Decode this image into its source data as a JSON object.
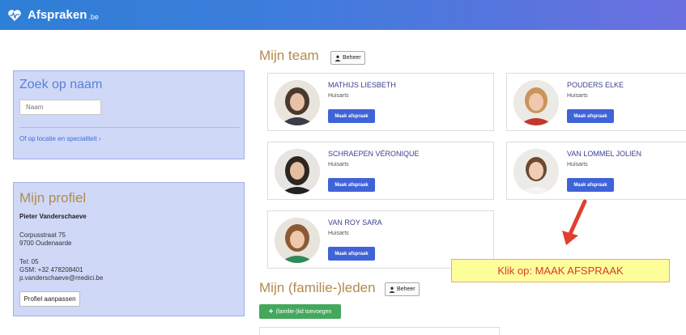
{
  "app": {
    "brand_name": "Afspraken",
    "brand_suffix": ".be"
  },
  "search_panel": {
    "title": "Zoek op naam",
    "input_placeholder": "Naam",
    "location_link": "Of op locatie en specialiteit ›"
  },
  "profile_panel": {
    "title": "Mijn profiel",
    "name": "Pieter Vanderschaeve",
    "street": "Corpusstraat 75",
    "city": "9700 Oudenaarde",
    "tel": "Tel: 05",
    "gsm": "GSM: +32 478208401",
    "email": "p.vanderschaeve@medici.be",
    "edit_button": "Profiel aanpassen"
  },
  "team": {
    "title": "Mijn team",
    "manage_button": "Beheer",
    "doctors": [
      {
        "name": "MATHIJS LIESBETH",
        "role": "Huisarts",
        "button": "Maak afspraak"
      },
      {
        "name": "POUDERS ELKE",
        "role": "Huisarts",
        "button": "Maak afspraak"
      },
      {
        "name": "SCHRAEPEN VÉRONIQUE",
        "role": "Huisarts",
        "button": "Maak afspraak"
      },
      {
        "name": "VAN LOMMEL JOLIEN",
        "role": "Huisarts",
        "button": "Maak afspraak"
      },
      {
        "name": "VAN ROY SARA",
        "role": "Huisarts",
        "button": "Maak afspraak"
      }
    ]
  },
  "family": {
    "title": "Mijn (familie-)leden",
    "manage_button": "Beheer",
    "add_button": "(familie-)lid toevoegen"
  },
  "annotation": {
    "text": "Klik op: MAAK AFSPRAAK",
    "text_color": "#d93a2b",
    "background": "#fdfd9a"
  },
  "colors": {
    "topbar": "#3d7ddb",
    "panel_bg": "#cfd8f7",
    "primary_button": "#3f63d8",
    "add_button": "#43a85c",
    "section_title": "#b38a4e"
  }
}
